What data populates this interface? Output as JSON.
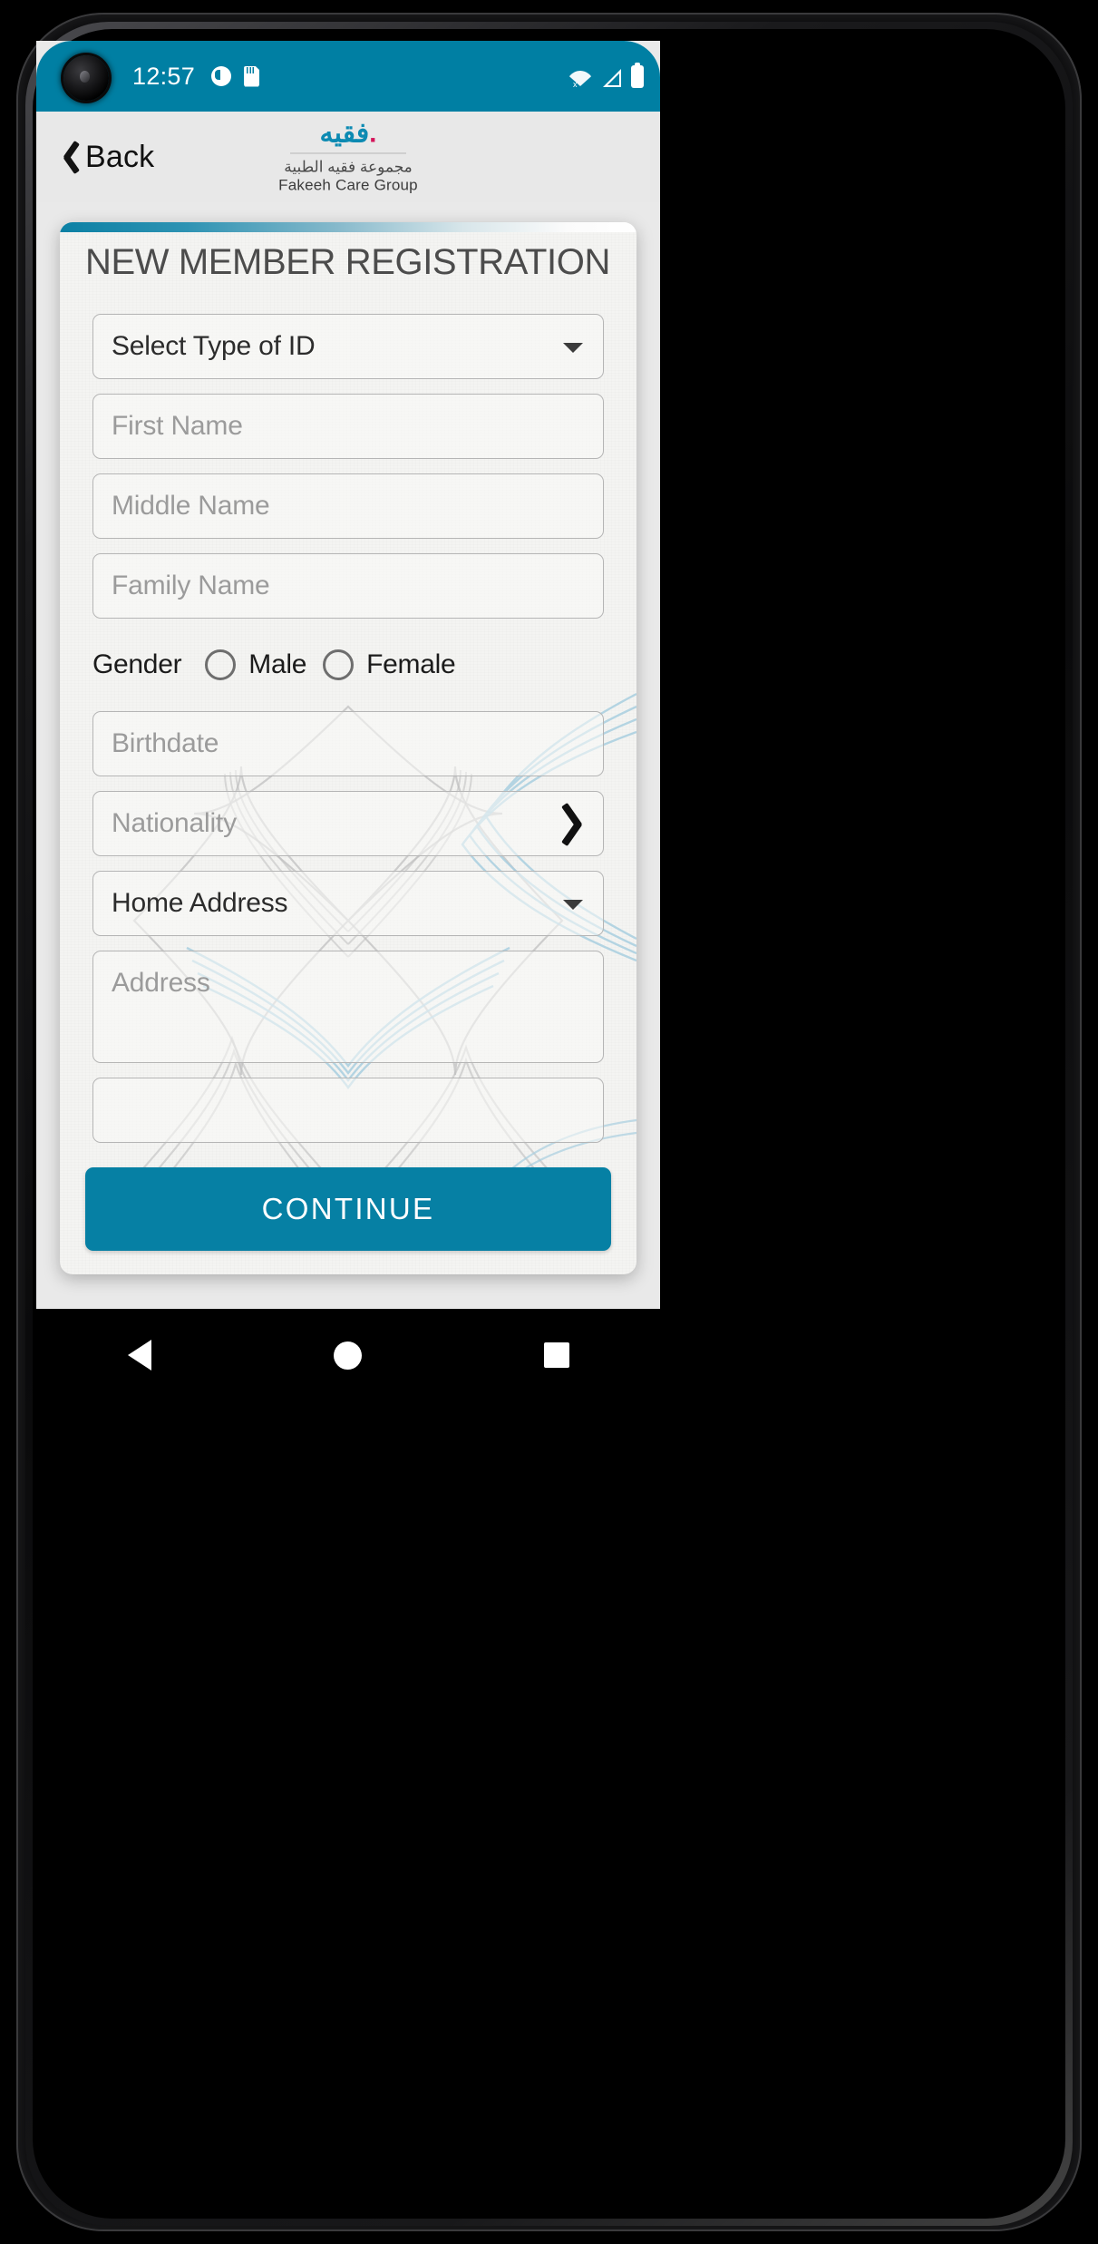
{
  "theme": {
    "accent_teal": "#007FA3",
    "button_teal": "#0680A4",
    "brand_blue": "#0C8AB2",
    "brand_magenta": "#D4145A",
    "card_bg": "#F4F4F2",
    "header_bg": "#E8E8E8",
    "field_border": "#B5B5B5",
    "placeholder_gray": "#9B9B9B",
    "value_dark": "#2C2C2C",
    "watermark_blue": "#9CC8DC",
    "watermark_gray": "#BEBEBE"
  },
  "status_bar": {
    "time": "12:57",
    "left_icons": [
      "alarm-icon",
      "sd-card-icon"
    ],
    "right_icons": [
      "wifi-off-icon",
      "cellular-signal-icon",
      "battery-icon"
    ]
  },
  "header": {
    "back_label": "Back",
    "back_icon": "chevron-left-icon",
    "logo": {
      "arabic_wordmark": "فقيه",
      "arabic_subtitle": "مجموعة فقيه الطبية",
      "english_subtitle": "Fakeeh Care Group"
    }
  },
  "card": {
    "title": "NEW MEMBER REGISTRATION"
  },
  "form": {
    "fields": [
      {
        "name": "type-of-id",
        "text": "Select Type of ID",
        "kind": "dropdown",
        "filled": true,
        "trailing_icon": "chevron-down-icon"
      },
      {
        "name": "first-name",
        "text": "First Name",
        "kind": "text",
        "filled": false,
        "trailing_icon": ""
      },
      {
        "name": "middle-name",
        "text": "Middle Name",
        "kind": "text",
        "filled": false,
        "trailing_icon": ""
      },
      {
        "name": "family-name",
        "text": "Family Name",
        "kind": "text",
        "filled": false,
        "trailing_icon": ""
      }
    ],
    "gender": {
      "label": "Gender",
      "options": [
        {
          "label": "Male",
          "selected": false
        },
        {
          "label": "Female",
          "selected": false
        }
      ]
    },
    "fields2": [
      {
        "name": "birthdate",
        "text": "Birthdate",
        "kind": "date",
        "filled": false,
        "trailing_icon": ""
      },
      {
        "name": "nationality",
        "text": "Nationality",
        "kind": "picker",
        "filled": false,
        "trailing_icon": "chevron-right-icon"
      },
      {
        "name": "home-address",
        "text": "Home Address",
        "kind": "dropdown",
        "filled": true,
        "trailing_icon": "chevron-down-icon"
      },
      {
        "name": "address",
        "text": "Address",
        "kind": "textarea",
        "filled": false,
        "trailing_icon": ""
      }
    ]
  },
  "continue_button": {
    "label": "CONTINUE"
  },
  "nav_bar": {
    "back": "triangle-back-icon",
    "home": "circle-home-icon",
    "recents": "square-recents-icon"
  }
}
